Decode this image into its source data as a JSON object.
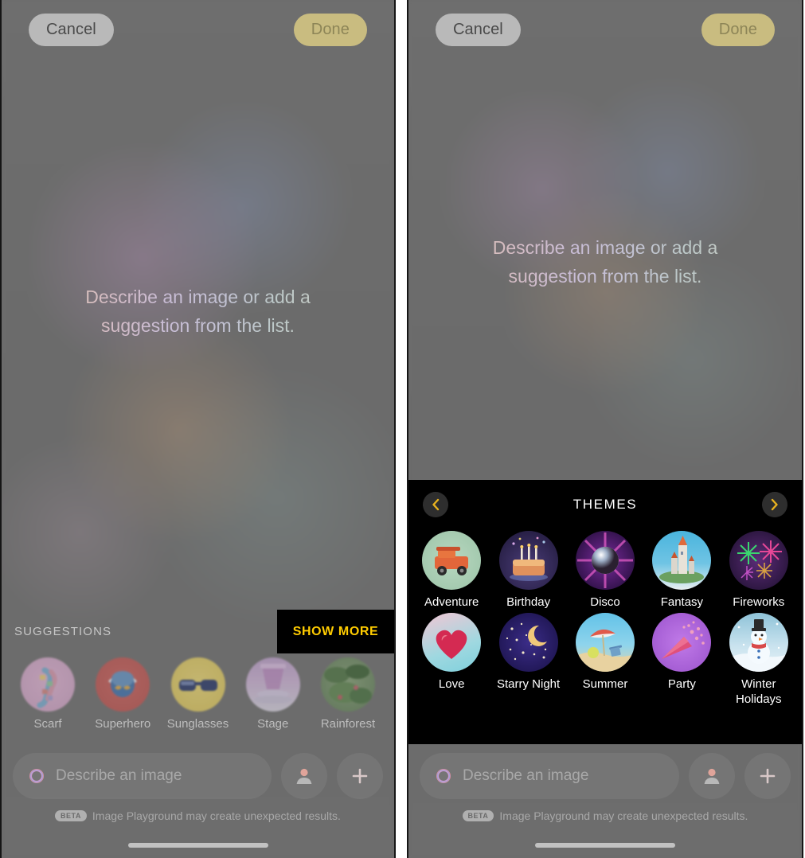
{
  "app": {
    "name": "Image Playground",
    "accent_yellow": "#ffcc00",
    "chevron_gold": "#e8b21f",
    "panel_bg": "#6c6c6c",
    "themes_bg": "#000000"
  },
  "topbar": {
    "cancel_label": "Cancel",
    "done_label": "Done"
  },
  "prompt": {
    "line1": "Describe an image or add a",
    "line2": "suggestion from the list."
  },
  "suggestions": {
    "title": "SUGGESTIONS",
    "show_more_label": "SHOW MORE",
    "items": [
      {
        "label": "Scarf",
        "icon": "scarf-thumbnail"
      },
      {
        "label": "Superhero",
        "icon": "superhero-thumbnail"
      },
      {
        "label": "Sunglasses",
        "icon": "sunglasses-thumbnail"
      },
      {
        "label": "Stage",
        "icon": "stage-thumbnail"
      },
      {
        "label": "Rainforest",
        "icon": "rainforest-thumbnail"
      }
    ]
  },
  "input_bar": {
    "placeholder": "Describe an image",
    "playground_icon": "image-playground-icon",
    "person_icon": "person-icon",
    "add_icon": "plus-icon",
    "beta_badge": "BETA",
    "disclaimer": "Image Playground may create unexpected results."
  },
  "themes": {
    "title": "THEMES",
    "prev_icon": "chevron-left-icon",
    "next_icon": "chevron-right-icon",
    "items": [
      {
        "label": "Adventure",
        "label2": "",
        "icon": "adventure-theme-thumbnail"
      },
      {
        "label": "Birthday",
        "label2": "",
        "icon": "birthday-theme-thumbnail"
      },
      {
        "label": "Disco",
        "label2": "",
        "icon": "disco-theme-thumbnail"
      },
      {
        "label": "Fantasy",
        "label2": "",
        "icon": "fantasy-theme-thumbnail"
      },
      {
        "label": "Fireworks",
        "label2": "",
        "icon": "fireworks-theme-thumbnail"
      },
      {
        "label": "Love",
        "label2": "",
        "icon": "love-theme-thumbnail"
      },
      {
        "label": "Starry Night",
        "label2": "",
        "icon": "starry-night-theme-thumbnail"
      },
      {
        "label": "Summer",
        "label2": "",
        "icon": "summer-theme-thumbnail"
      },
      {
        "label": "Party",
        "label2": "",
        "icon": "party-theme-thumbnail"
      },
      {
        "label": "Winter",
        "label2": "Holidays",
        "icon": "winter-holidays-theme-thumbnail"
      }
    ]
  }
}
